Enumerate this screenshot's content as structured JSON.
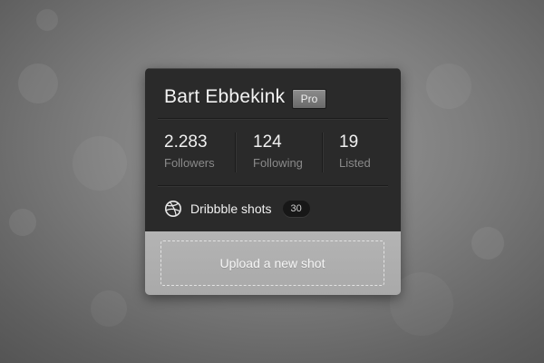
{
  "profile": {
    "name": "Bart Ebbekink",
    "badge": "Pro"
  },
  "stats": [
    {
      "value": "2.283",
      "label": "Followers"
    },
    {
      "value": "124",
      "label": "Following"
    },
    {
      "value": "19",
      "label": "Listed"
    }
  ],
  "shots": {
    "icon": "dribbble-ball-icon",
    "label": "Dribbble shots",
    "count": "30"
  },
  "upload": {
    "label": "Upload a new shot"
  },
  "colors": {
    "card_dark": "#2a2a2a",
    "card_light": "#b0b0b0",
    "text_primary": "#f0f0f0",
    "text_muted": "#8a8a8a"
  }
}
